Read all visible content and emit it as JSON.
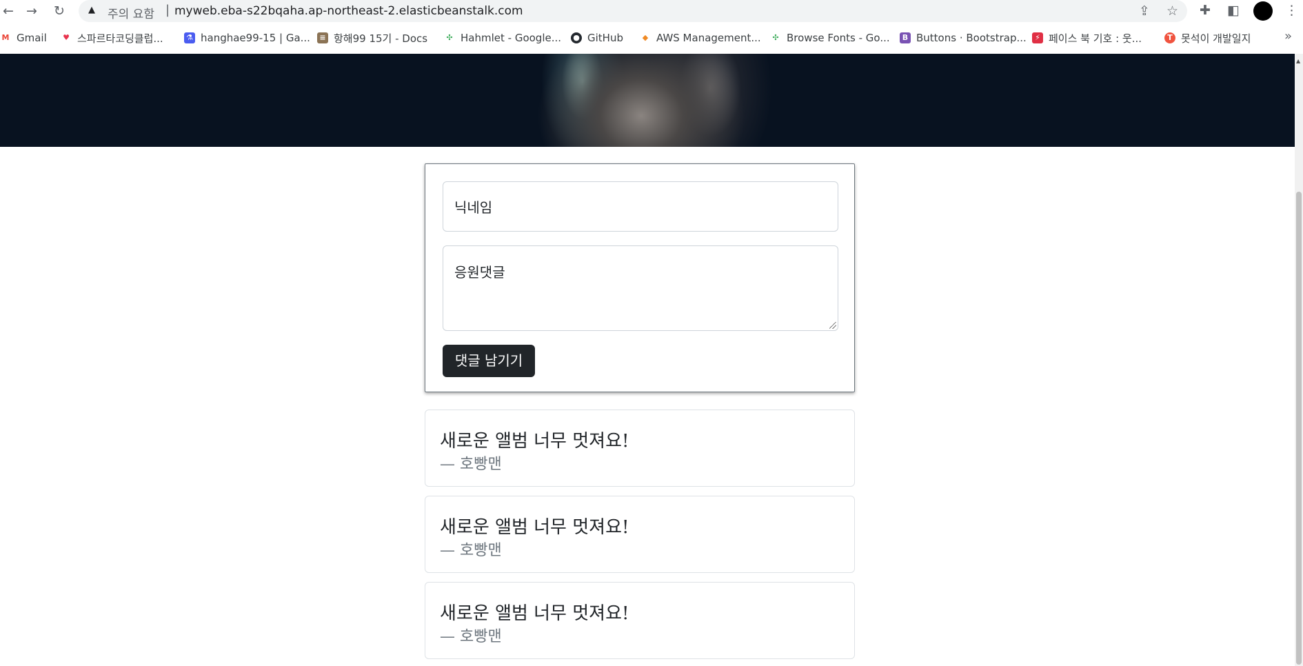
{
  "browser": {
    "security_warning": "주의 요함",
    "separator": "|",
    "url": "myweb.eba-s22bqaha.ap-northeast-2.elasticbeanstalk.com",
    "icons": [
      "back-icon",
      "forward-icon",
      "reload-icon",
      "warning-icon",
      "share-icon",
      "star-icon",
      "puzzle-icon",
      "side-panel-icon",
      "avatar",
      "kebab-menu-icon"
    ]
  },
  "bookmarks": [
    {
      "label": "Gmail",
      "icon": "M",
      "color": "#ea4335"
    },
    {
      "label": "스파르타코딩클럽...",
      "icon": "♥",
      "color": "#e8344e"
    },
    {
      "label": "hanghae99-15 | Ga...",
      "icon": "⚗",
      "color": "#4a5cf0"
    },
    {
      "label": "항해99 15기 - Docs",
      "icon": "≡",
      "color": "#8b7355"
    },
    {
      "label": "Hahmlet - Google...",
      "icon": "✣",
      "color": "#34a853"
    },
    {
      "label": "GitHub",
      "icon": "●",
      "color": "#24292f"
    },
    {
      "label": "AWS Management...",
      "icon": "◆",
      "color": "#f08a24"
    },
    {
      "label": "Browse Fonts - Go...",
      "icon": "✣",
      "color": "#34a853"
    },
    {
      "label": "Buttons · Bootstrap...",
      "icon": "B",
      "color": "#7952b3"
    },
    {
      "label": "페이스 북 기호 : 웃...",
      "icon": "⚡",
      "color": "#e02f44"
    },
    {
      "label": "못석이 개발일지",
      "icon": "T",
      "color": "#f0533f"
    }
  ],
  "bookmarks_more": "»",
  "form": {
    "nickname_placeholder": "닉네임",
    "comment_placeholder": "응원댓글",
    "submit_label": "댓글 남기기"
  },
  "comments": [
    {
      "text": "새로운 앨범 너무 멋져요!",
      "author": "— 호빵맨"
    },
    {
      "text": "새로운 앨범 너무 멋져요!",
      "author": "— 호빵맨"
    },
    {
      "text": "새로운 앨범 너무 멋져요!",
      "author": "— 호빵맨"
    }
  ]
}
